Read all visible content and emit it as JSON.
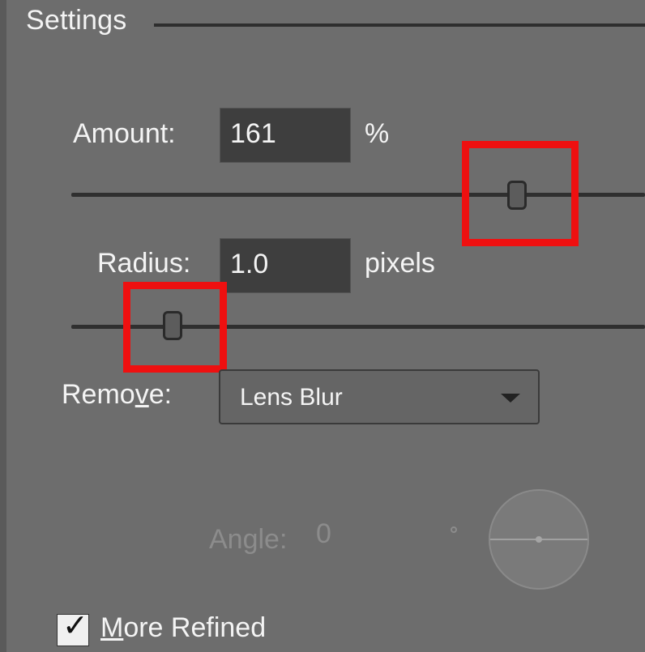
{
  "section": {
    "title": "Settings"
  },
  "amount": {
    "label": "Amount:",
    "value": "161",
    "unit": "%",
    "slider_fraction": 0.78,
    "highlighted": true
  },
  "radius": {
    "label": "Radius:",
    "value": "1.0",
    "unit": "pixels",
    "slider_fraction": 0.17,
    "highlighted": true
  },
  "remove": {
    "label_before": "Remo",
    "label_underlined": "v",
    "label_after": "e:",
    "selected": "Lens Blur"
  },
  "angle": {
    "label": "Angle:",
    "value": "0",
    "degree_symbol": "°",
    "enabled": false
  },
  "more_refined": {
    "checked": true,
    "label_underlined": "M",
    "label_rest": "ore Refined"
  },
  "colors": {
    "highlight": "#ee1010",
    "panel_bg": "#6d6d6d",
    "field_bg": "#3e3e3e"
  },
  "icons": {
    "dropdown": "chevron-down-icon",
    "checkmark": "checkmark-icon",
    "angle_wheel": "angle-dial-icon"
  }
}
